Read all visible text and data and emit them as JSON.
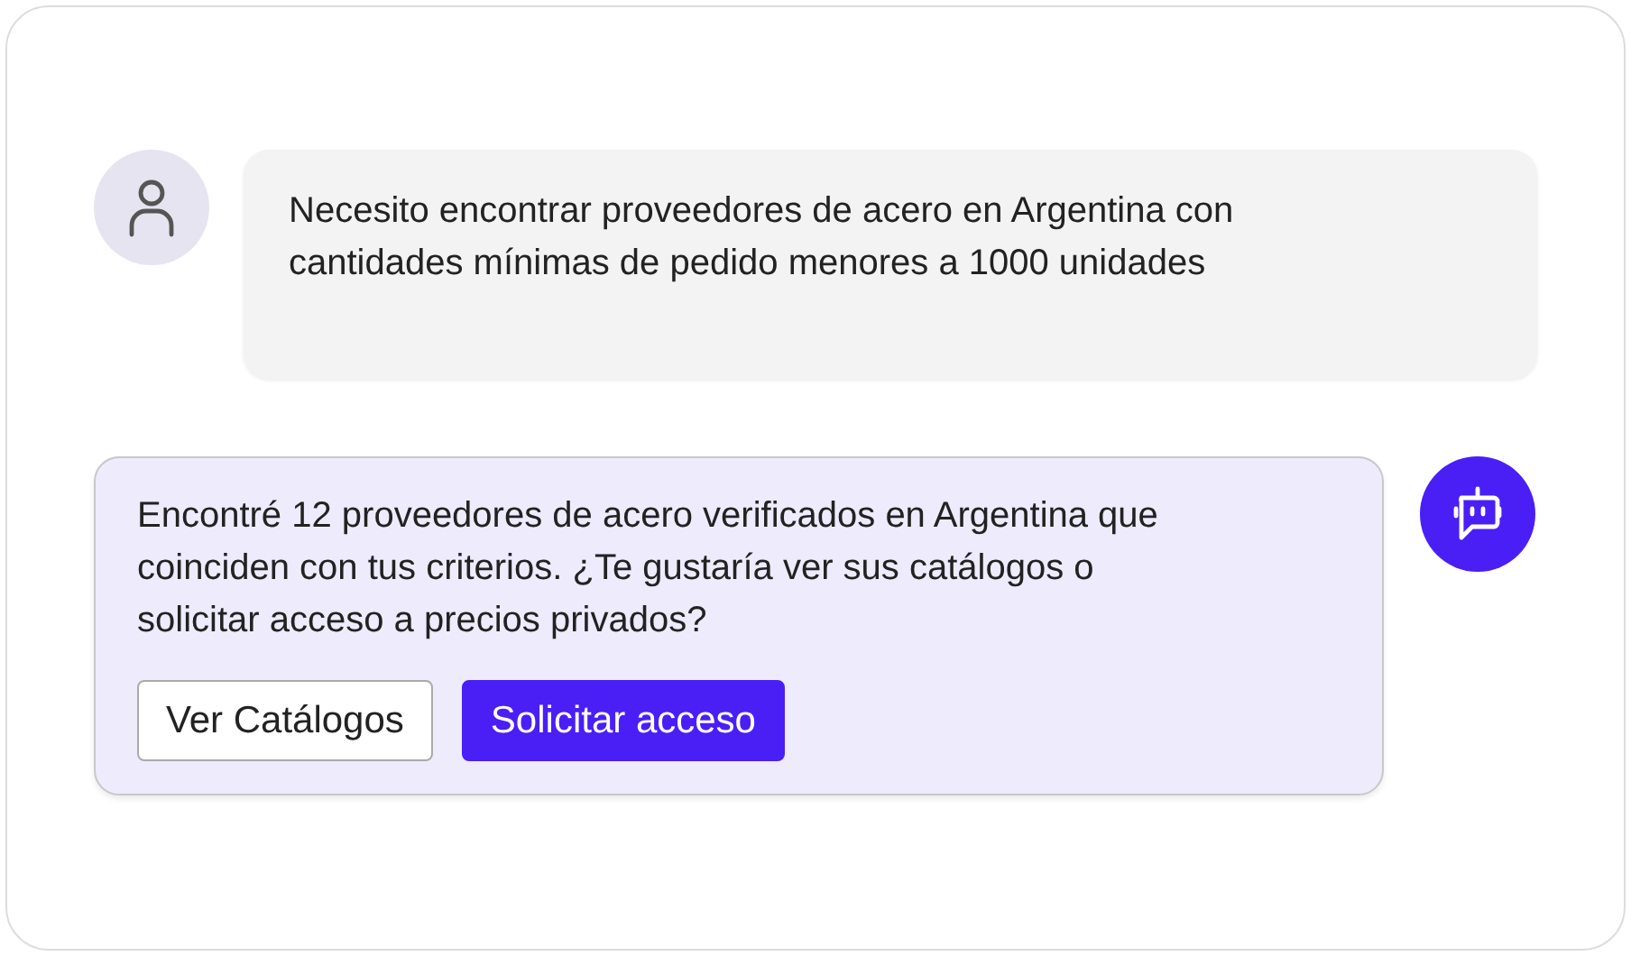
{
  "messages": [
    {
      "kind": "user",
      "text": "Necesito encontrar proveedores de acero en Argentina con cantidades mínimas de pedido menores a 1000 unidades"
    },
    {
      "kind": "bot",
      "text": "Encontré 12 proveedores de acero verificados en Argentina que coinciden con tus criterios. ¿Te gustaría ver sus catálogos o solicitar acceso a precios privados?",
      "actions": [
        {
          "label": "Ver Catálogos",
          "kind": "secondary"
        },
        {
          "label": "Solicitar acceso",
          "kind": "primary"
        }
      ]
    }
  ]
}
